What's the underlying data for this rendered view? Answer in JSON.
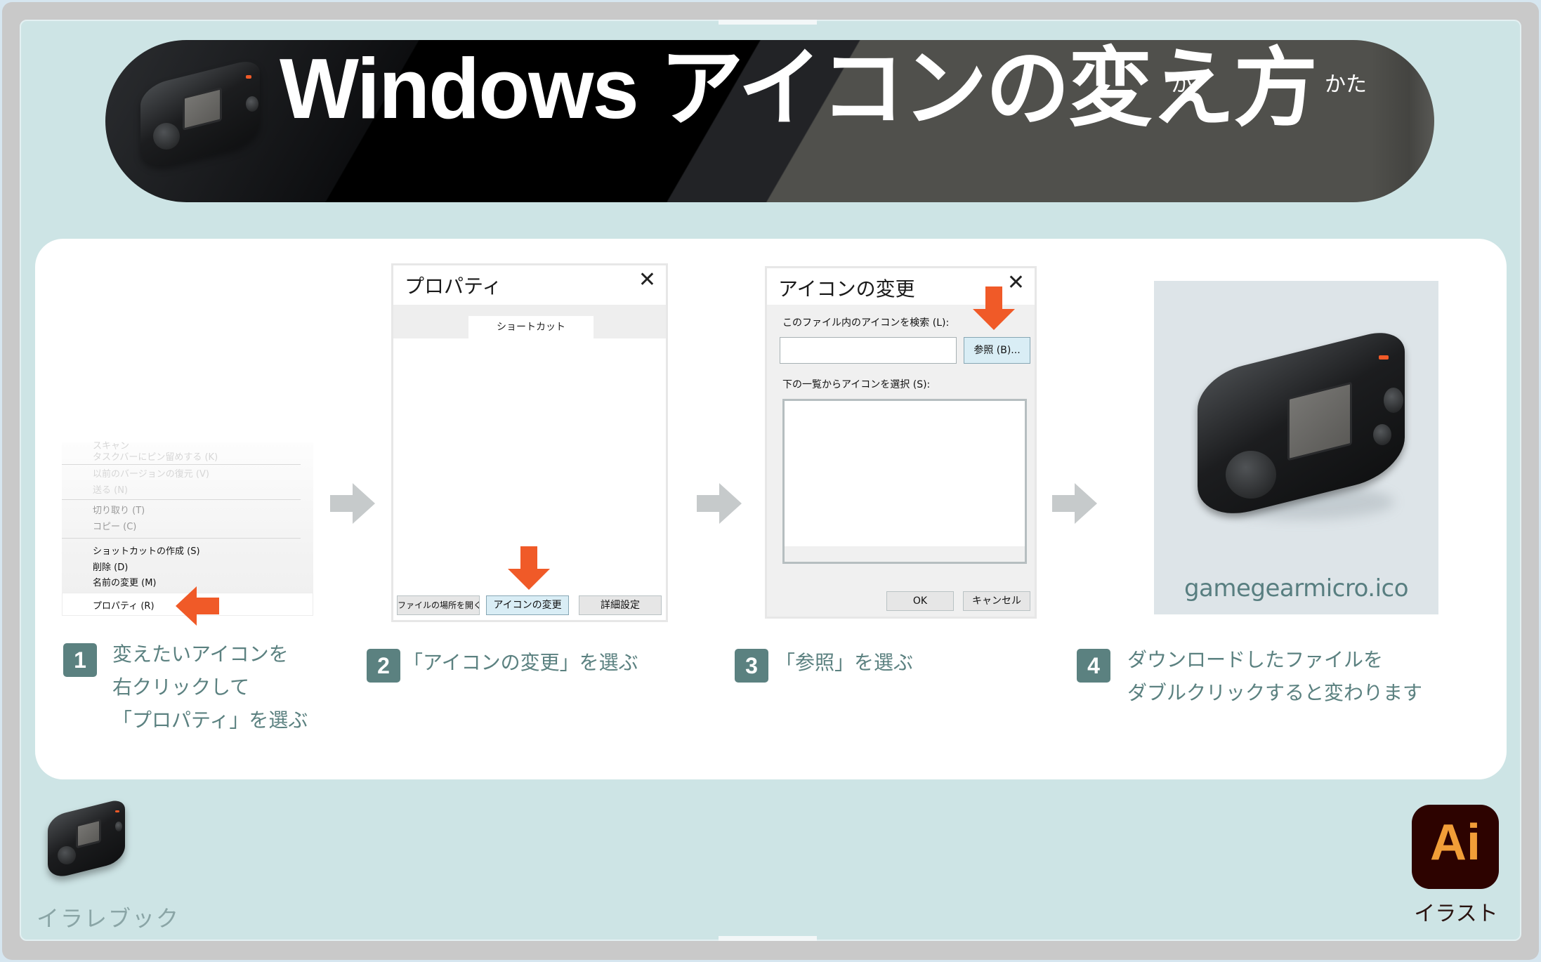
{
  "header": {
    "title": "Windows アイコンの変え方",
    "ruby": [
      "か",
      "かた"
    ]
  },
  "step1": {
    "context_menu": {
      "items": [
        {
          "label": "スキャン",
          "state": "faded"
        },
        {
          "label": "タスクバーにピン留めする (K)",
          "state": "faded"
        },
        {
          "label": "以前のバージョンの復元 (V)",
          "state": "faded"
        },
        {
          "label": "送る (N)",
          "state": "faded"
        },
        {
          "label": "切り取り (T)",
          "state": "mid"
        },
        {
          "label": "コピー (C)",
          "state": "mid"
        },
        {
          "label": "ショットカットの作成 (S)",
          "state": "normal"
        },
        {
          "label": "削除 (D)",
          "state": "normal"
        },
        {
          "label": "名前の変更 (M)",
          "state": "normal"
        },
        {
          "label": "プロパティ (R)",
          "state": "selected"
        }
      ]
    },
    "number": "1",
    "caption": "変えたいアイコンを\n右クリックして\n「プロパティ」を選ぶ"
  },
  "step2": {
    "dialog": {
      "title": "プロパティ",
      "close": "✕",
      "tab": "ショートカット",
      "buttons": [
        "ファイルの場所を開く",
        "アイコンの変更",
        "詳細設定"
      ]
    },
    "number": "2",
    "caption": "「アイコンの変更」を選ぶ"
  },
  "step3": {
    "dialog": {
      "title": "アイコンの変更",
      "close": "✕",
      "search_label": "このファイル内のアイコンを検索 (L):",
      "path_value": "",
      "browse_button": "参照 (B)...",
      "list_label": "下の一覧からアイコンを選択 (S):",
      "ok_button": "OK",
      "cancel_button": "キャンセル"
    },
    "number": "3",
    "caption": "「参照」を選ぶ"
  },
  "step4": {
    "file_name": "gamegearmicro.ico",
    "number": "4",
    "caption": "ダウンロードしたファイルを\nダブルクリックすると変わります"
  },
  "footer": {
    "brand": "イラレブック",
    "app_icon_text": "Ai",
    "app_label": "イラスト"
  },
  "colors": {
    "accent_orange": "#f05a28",
    "step_teal": "#5b8180",
    "board_bg": "#cde4e5",
    "ai_bg": "#2d0300",
    "ai_fg": "#f19e38"
  }
}
